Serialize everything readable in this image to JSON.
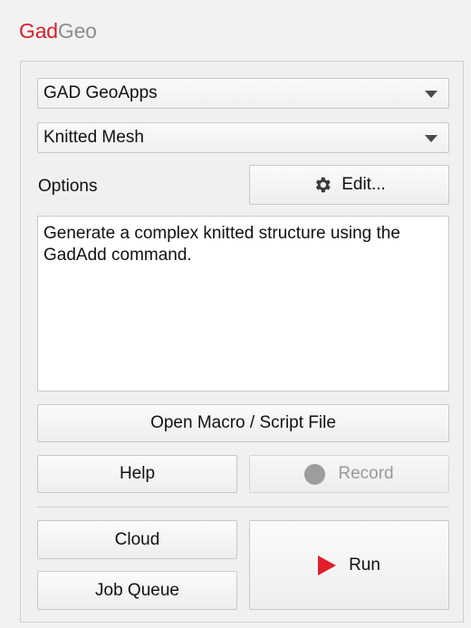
{
  "app": {
    "title_brand": "Gad",
    "title_rest": "Geo",
    "brand_color": "#d8202c",
    "muted_color": "#8d8d8d"
  },
  "selectors": {
    "app_select_value": "GAD GeoApps",
    "tool_select_value": "Knitted Mesh"
  },
  "options": {
    "label": "Options",
    "edit_label": "Edit...",
    "edit_icon": "gear-icon"
  },
  "description": {
    "text": "Generate a complex knitted structure using the GadAdd command."
  },
  "actions": {
    "open_macro_label": "Open Macro / Script File",
    "help_label": "Help",
    "record_label": "Record",
    "record_icon": "record-dot-icon",
    "cloud_label": "Cloud",
    "job_queue_label": "Job Queue",
    "run_label": "Run",
    "run_icon": "play-icon",
    "run_color": "#e01f2b"
  }
}
